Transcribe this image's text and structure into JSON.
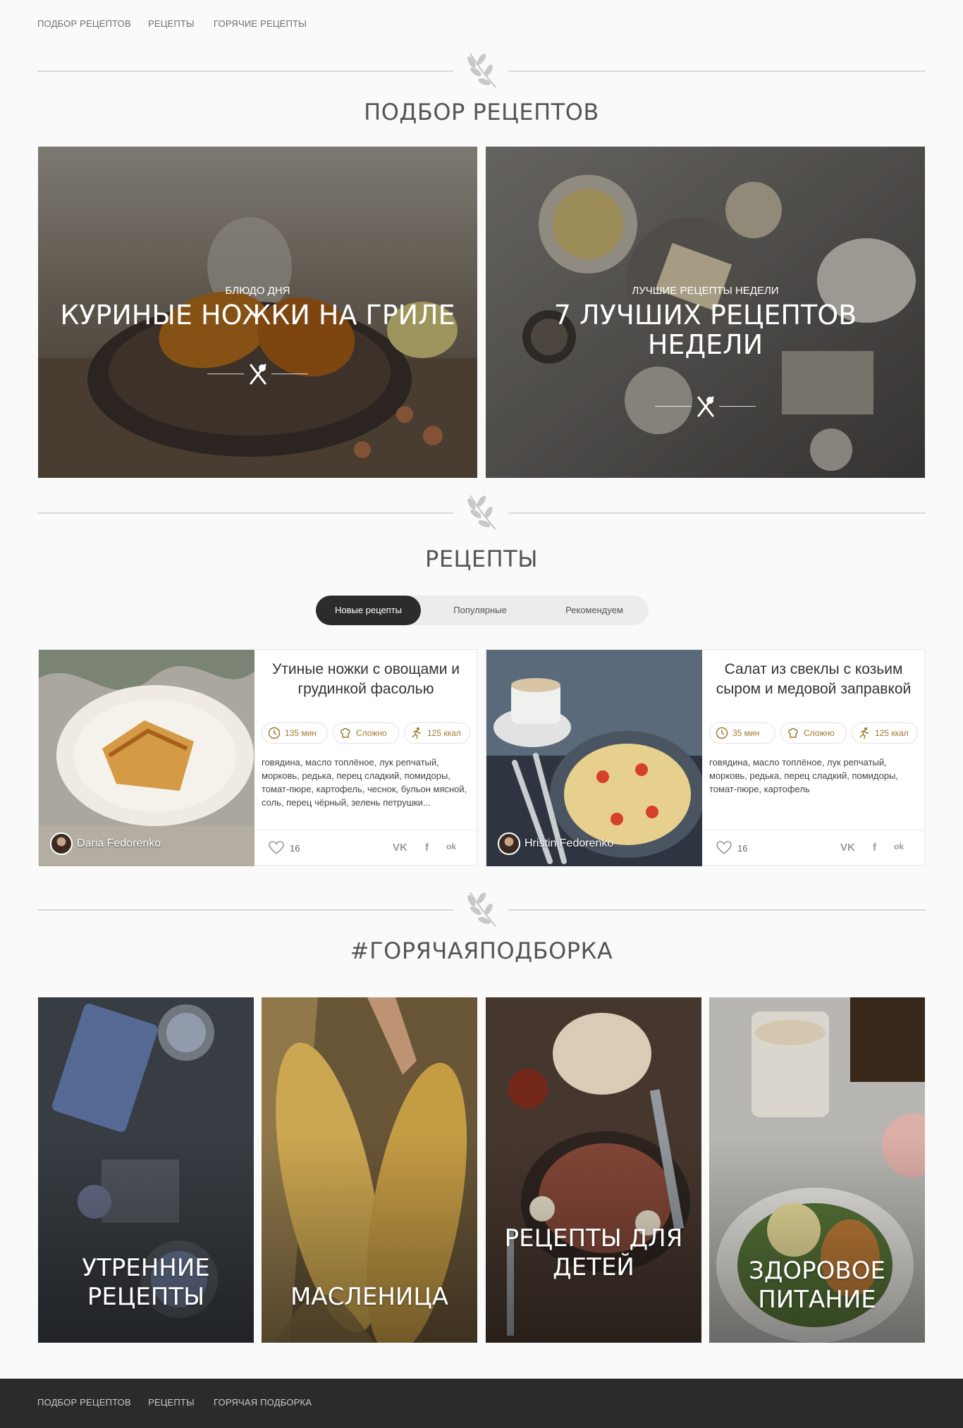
{
  "top_nav": {
    "items": [
      "ПОДБОР РЕЦЕПТОВ",
      "РЕЦЕПТЫ",
      "ГОРЯЧИЕ РЕЦЕПТЫ"
    ]
  },
  "sections": {
    "selection_title": "ПОДБОР РЕЦЕПТОВ",
    "recipes_title": "РЕЦЕПТЫ",
    "hot_title": "#ГОРЯЧАЯПОДБОРКА"
  },
  "features": [
    {
      "kicker": "БЛЮДО ДНЯ",
      "title": "КУРИНЫЕ НОЖКИ НА ГРИЛЕ"
    },
    {
      "kicker": "ЛУЧШИЕ РЕЦЕПТЫ НЕДЕЛИ",
      "title": "7 ЛУЧШИХ РЕЦЕПТОВ НЕДЕЛИ"
    }
  ],
  "tabs": {
    "items": [
      "Новые рецепты",
      "Популярные",
      "Рекомендуем"
    ],
    "active": "Новые рецепты"
  },
  "recipes": [
    {
      "title": "Утиные ножки с овощами и грудинкой фасолью",
      "time": "135 мин",
      "difficulty": "Сложно",
      "calories": "125 ккал",
      "ingredients": "говядина, масло топлёное, лук репчатый, морковь, редька, перец сладкий, помидоры, томат-пюре, картофель, чеснок, бульон мясной, соль, перец чёрный, зелень петрушки...",
      "author": "Daria Fedorenko",
      "likes": "16"
    },
    {
      "title": "Салат из свеклы с козьим сыром и медовой заправкой",
      "time": "35 мин",
      "difficulty": "Сложно",
      "calories": "125 ккал",
      "ingredients": "говядина, масло топлёное, лук репчатый, морковь, редька, перец сладкий, помидоры, томат-пюре, картофель",
      "author": "Hristin Fedorenko",
      "likes": "16"
    }
  ],
  "share": {
    "vk": "VK",
    "fb": "f",
    "ok": "ok"
  },
  "hot": [
    {
      "label": "УТРЕННИЕ РЕЦЕПТЫ"
    },
    {
      "label": "МАСЛЕНИЦА"
    },
    {
      "label": "РЕЦЕПТЫ ДЛЯ ДЕТЕЙ"
    },
    {
      "label": "ЗДОРОВОЕ ПИТАНИЕ"
    }
  ],
  "footer_nav": {
    "items": [
      "ПОДБОР РЕЦЕПТОВ",
      "РЕЦЕПТЫ",
      "ГОРЯЧАЯ ПОДБОРКА"
    ]
  },
  "icons": {
    "ornament": "olive-branch-icon",
    "fork_knife": "fork-knife-icon",
    "clock": "clock-icon",
    "chef_hat": "chef-hat-icon",
    "calories": "running-person-icon",
    "heart": "heart-icon"
  },
  "colors": {
    "accent": "#a07a2e",
    "tab_active": "#2b2c2e",
    "footer_bg": "#2a2b2d"
  }
}
